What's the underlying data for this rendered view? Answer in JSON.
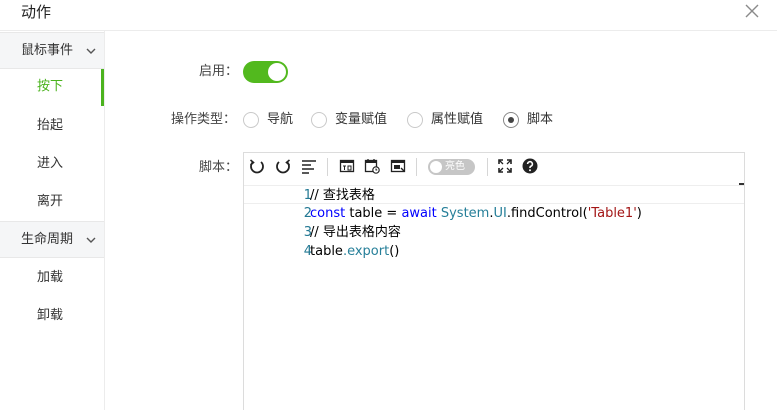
{
  "dialog": {
    "title": "动作"
  },
  "sidebar": {
    "groups": [
      {
        "label": "鼠标事件",
        "items": [
          {
            "label": "按下",
            "active": true
          },
          {
            "label": "抬起"
          },
          {
            "label": "进入"
          },
          {
            "label": "离开"
          }
        ]
      },
      {
        "label": "生命周期",
        "items": [
          {
            "label": "加载"
          },
          {
            "label": "卸载"
          }
        ]
      }
    ]
  },
  "form": {
    "enable_label": "启用：",
    "enable_on": true,
    "action_type_label": "操作类型：",
    "action_types": [
      {
        "label": "导航",
        "checked": false
      },
      {
        "label": "变量赋值",
        "checked": false
      },
      {
        "label": "属性赋值",
        "checked": false
      },
      {
        "label": "脚本",
        "checked": true
      }
    ],
    "script_label": "脚本："
  },
  "editor": {
    "theme_toggle_label": "亮色",
    "lines": [
      {
        "num": "1",
        "text": "// 查找表格"
      },
      {
        "num": "2",
        "text": "const table = await System.UI.findControl('Table1')"
      },
      {
        "num": "3",
        "text": "// 导出表格内容"
      },
      {
        "num": "4",
        "text": "table.export()"
      }
    ]
  },
  "colors": {
    "accent": "#4bb31e",
    "toggle_on": "#52b91e",
    "line_number": "#237893",
    "comment": "#008000",
    "keyword": "#0000ff",
    "string": "#a31515"
  }
}
